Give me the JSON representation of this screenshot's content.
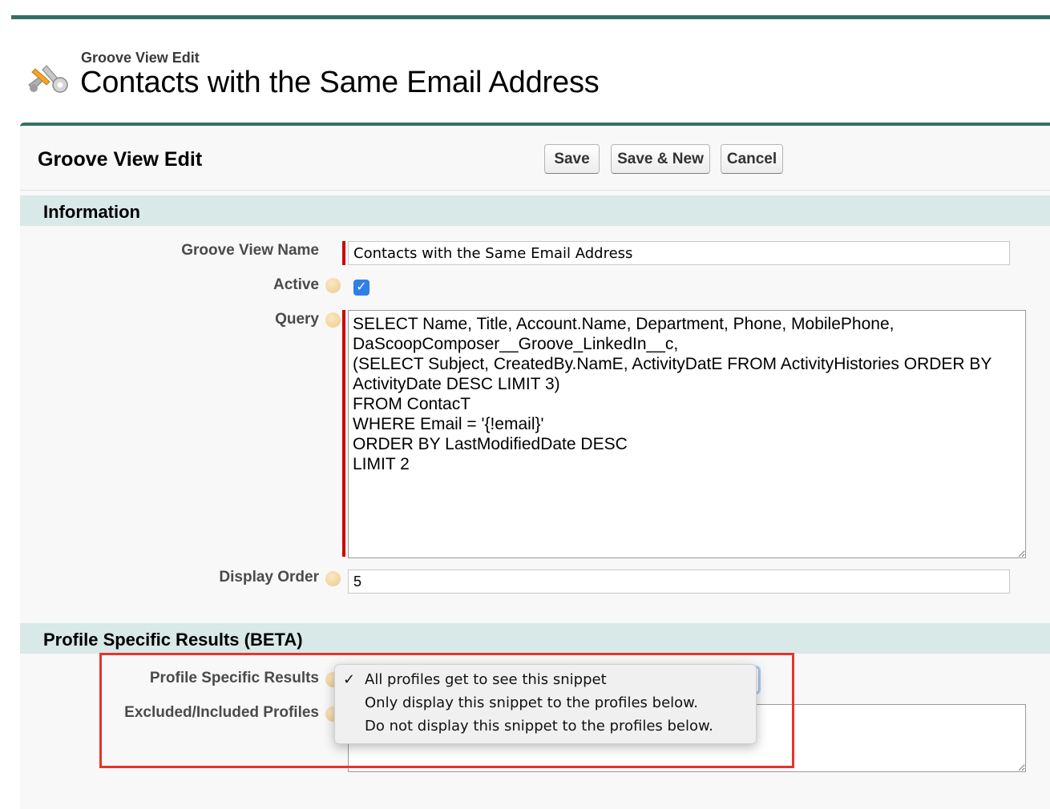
{
  "header": {
    "subtitle": "Groove View Edit",
    "title": "Contacts with the Same Email Address",
    "icon": "tools-icon"
  },
  "panel": {
    "title": "Groove View Edit",
    "buttons": {
      "save": "Save",
      "save_new": "Save & New",
      "cancel": "Cancel"
    }
  },
  "information": {
    "section_title": "Information",
    "name_label": "Groove View Name",
    "name_value": "Contacts with the Same Email Address",
    "active_label": "Active",
    "active_checked": true,
    "query_label": "Query",
    "query_value": "SELECT Name, Title, Account.Name, Department, Phone, MobilePhone,\nDaScoopComposer__Groove_LinkedIn__c,\n(SELECT Subject, CreatedBy.NamE, ActivityDatE FROM ActivityHistories ORDER BY\nActivityDate DESC LIMIT 3)\nFROM ContacT\nWHERE Email = '{!email}'\nORDER BY LastModifiedDate DESC\nLIMIT 2",
    "display_order_label": "Display Order",
    "display_order_value": "5"
  },
  "profile_section": {
    "section_title": "Profile Specific Results (BETA)",
    "results_label": "Profile Specific Results",
    "profiles_label": "Excluded/Included Profiles",
    "dropdown_options": [
      {
        "label": "All profiles get to see this snippet",
        "selected": true
      },
      {
        "label": "Only display this snippet to the profiles below.",
        "selected": false
      },
      {
        "label": "Do not display this snippet to the profiles below.",
        "selected": false
      }
    ],
    "check_mark": "✓"
  },
  "colors": {
    "accent": "#336f63",
    "section_background": "#d8e9e7",
    "required": "#cc0000",
    "highlight": "#e8332a"
  }
}
